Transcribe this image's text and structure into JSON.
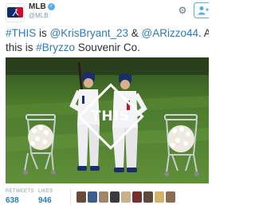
{
  "account": {
    "name": "MLB",
    "handle": "@MLB",
    "avatar_icon": "mlb-logo-icon",
    "brand_blue": "#0d2a6b",
    "brand_red": "#c8102e"
  },
  "tweet": {
    "segments": [
      {
        "text": "#THIS",
        "link": true
      },
      {
        "text": " is ",
        "link": false
      },
      {
        "text": "@KrisBryant_23",
        "link": true
      },
      {
        "text": " & ",
        "link": false
      },
      {
        "text": "@ARizzo44",
        "link": true
      },
      {
        "text": ". A",
        "link": false
      }
    ],
    "segments_line2": [
      {
        "text": "this is ",
        "link": false
      },
      {
        "text": "#Bryzzo",
        "link": true
      },
      {
        "text": " Souvenir Co.",
        "link": false
      }
    ],
    "link_color": "#2b7bb9"
  },
  "photo": {
    "overlay_text": "THIS"
  },
  "stats": {
    "retweets_label": "RETWEETS",
    "retweets_value": "638",
    "likes_label": "LIKES",
    "likes_value": "946"
  },
  "likers_colors": [
    "#6b4a3a",
    "#3d5e8c",
    "#a0876b",
    "#3a3a3a",
    "#c9b28a",
    "#7a2f2f",
    "#5c4a3c",
    "#d1b36a",
    "#8a6b55"
  ],
  "icons": {
    "settings": "gear-icon",
    "follow": "follow-person-icon",
    "verified": "verified-check-icon"
  }
}
